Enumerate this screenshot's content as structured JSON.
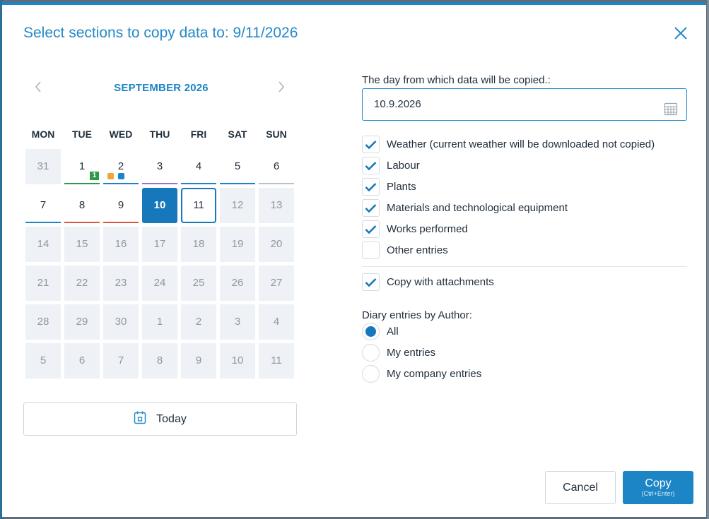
{
  "dialog": {
    "title": "Select sections to copy data to: 9/11/2026"
  },
  "calendar": {
    "month_label": "SEPTEMBER 2026",
    "weekdays": [
      "MON",
      "TUE",
      "WED",
      "THU",
      "FRI",
      "SAT",
      "SUN"
    ],
    "weeks": [
      [
        "31",
        "1",
        "2",
        "3",
        "4",
        "5",
        "6"
      ],
      [
        "7",
        "8",
        "9",
        "10",
        "11",
        "12",
        "13"
      ],
      [
        "14",
        "15",
        "16",
        "17",
        "18",
        "19",
        "20"
      ],
      [
        "21",
        "22",
        "23",
        "24",
        "25",
        "26",
        "27"
      ],
      [
        "28",
        "29",
        "30",
        "1",
        "2",
        "3",
        "4"
      ],
      [
        "5",
        "6",
        "7",
        "8",
        "9",
        "10",
        "11"
      ]
    ],
    "selected_day": "10",
    "today_day": "11",
    "badge_count": "1",
    "colors": {
      "accent": "#1b85c6",
      "selected": "#1678bb",
      "green": "#2e9a47",
      "purple": "#9b6fd0",
      "blue": "#1b85c6",
      "red": "#e0553b",
      "gray": "#b9c0c7",
      "orange": "#f0a63a"
    },
    "today_button_label": "Today"
  },
  "source_day": {
    "label": "The day from which data will be copied.:",
    "value": "10.9.2026"
  },
  "sections": [
    {
      "label": "Weather (current weather will be downloaded not copied)",
      "checked": true
    },
    {
      "label": "Labour",
      "checked": true
    },
    {
      "label": "Plants",
      "checked": true
    },
    {
      "label": "Materials and technological equipment",
      "checked": true
    },
    {
      "label": "Works performed",
      "checked": true
    },
    {
      "label": "Other entries",
      "checked": false
    }
  ],
  "copy_attachments": {
    "label": "Copy with attachments",
    "checked": true
  },
  "author": {
    "label": "Diary entries by Author:",
    "options": [
      {
        "label": "All",
        "selected": true
      },
      {
        "label": "My entries",
        "selected": false
      },
      {
        "label": "My company entries",
        "selected": false
      }
    ]
  },
  "buttons": {
    "cancel": "Cancel",
    "copy": "Copy",
    "copy_hint": "(Ctrl+Enter)"
  }
}
